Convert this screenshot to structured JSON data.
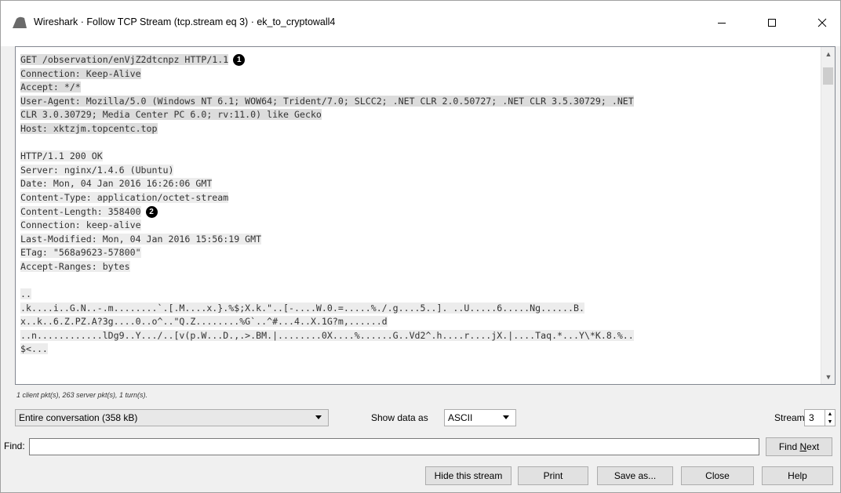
{
  "window": {
    "title": "Wireshark · Follow TCP Stream (tcp.stream eq 3) · ek_to_cryptowall4",
    "minimize_icon": "minimize-icon",
    "maximize_icon": "maximize-icon",
    "close_icon": "close-icon"
  },
  "stream": {
    "lines": [
      {
        "text": "GET /observation/enVjZ2dtcnpz HTTP/1.1",
        "side": "client",
        "marker": "1"
      },
      {
        "text": "Connection: Keep-Alive",
        "side": "client"
      },
      {
        "text": "Accept: */*",
        "side": "client"
      },
      {
        "text": "User-Agent: Mozilla/5.0 (Windows NT 6.1; WOW64; Trident/7.0; SLCC2; .NET CLR 2.0.50727; .NET CLR 3.5.30729; .NET",
        "side": "client"
      },
      {
        "text": "CLR 3.0.30729; Media Center PC 6.0; rv:11.0) like Gecko",
        "side": "client"
      },
      {
        "text": "Host: xktzjm.topcentc.top",
        "side": "client"
      },
      {
        "text": "",
        "side": "client"
      },
      {
        "text": "HTTP/1.1 200 OK",
        "side": "server"
      },
      {
        "text": "Server: nginx/1.4.6 (Ubuntu)",
        "side": "server"
      },
      {
        "text": "Date: Mon, 04 Jan 2016 16:26:06 GMT",
        "side": "server"
      },
      {
        "text": "Content-Type: application/octet-stream",
        "side": "server"
      },
      {
        "text": "Content-Length: 358400",
        "side": "server",
        "marker": "2"
      },
      {
        "text": "Connection: keep-alive",
        "side": "server"
      },
      {
        "text": "Last-Modified: Mon, 04 Jan 2016 15:56:19 GMT",
        "side": "server"
      },
      {
        "text": "ETag: \"568a9623-57800\"",
        "side": "server"
      },
      {
        "text": "Accept-Ranges: bytes",
        "side": "server"
      },
      {
        "text": "",
        "side": "server"
      },
      {
        "text": "..",
        "side": "server"
      },
      {
        "text": ".k....i..G.N..-.m........`.[.M....x.}.%$;X.k.\"..[-....W.0.=.....%./.g....5..]. ..U.....6.....Ng......B.",
        "side": "server"
      },
      {
        "text": "x..k..6.Z.PZ.A?3g....0..o^..\"Q.Z........%G`..^#...4..X.1G?m,......d",
        "side": "server"
      },
      {
        "text": "..n............lDg9..Y.../..[v(p.W...D.,.>.BM.|........0X....%......G..Vd2^.h....r....jX.|....Taq.*...Y\\*K.8.%..",
        "side": "server"
      },
      {
        "text": "$<...",
        "side": "server"
      }
    ]
  },
  "stats": "1 client pkt(s), 263 server pkt(s), 1 turn(s).",
  "conversation_select": {
    "value": "Entire conversation (358 kB)"
  },
  "show_data_as": {
    "label": "Show data as",
    "value": "ASCII"
  },
  "stream_select": {
    "label": "Stream",
    "value": "3"
  },
  "find": {
    "label": "Find:",
    "value": "",
    "button": "Find Next"
  },
  "buttons": {
    "hide": "Hide this stream",
    "print": "Print",
    "save_as": "Save as...",
    "close": "Close",
    "help": "Help"
  }
}
